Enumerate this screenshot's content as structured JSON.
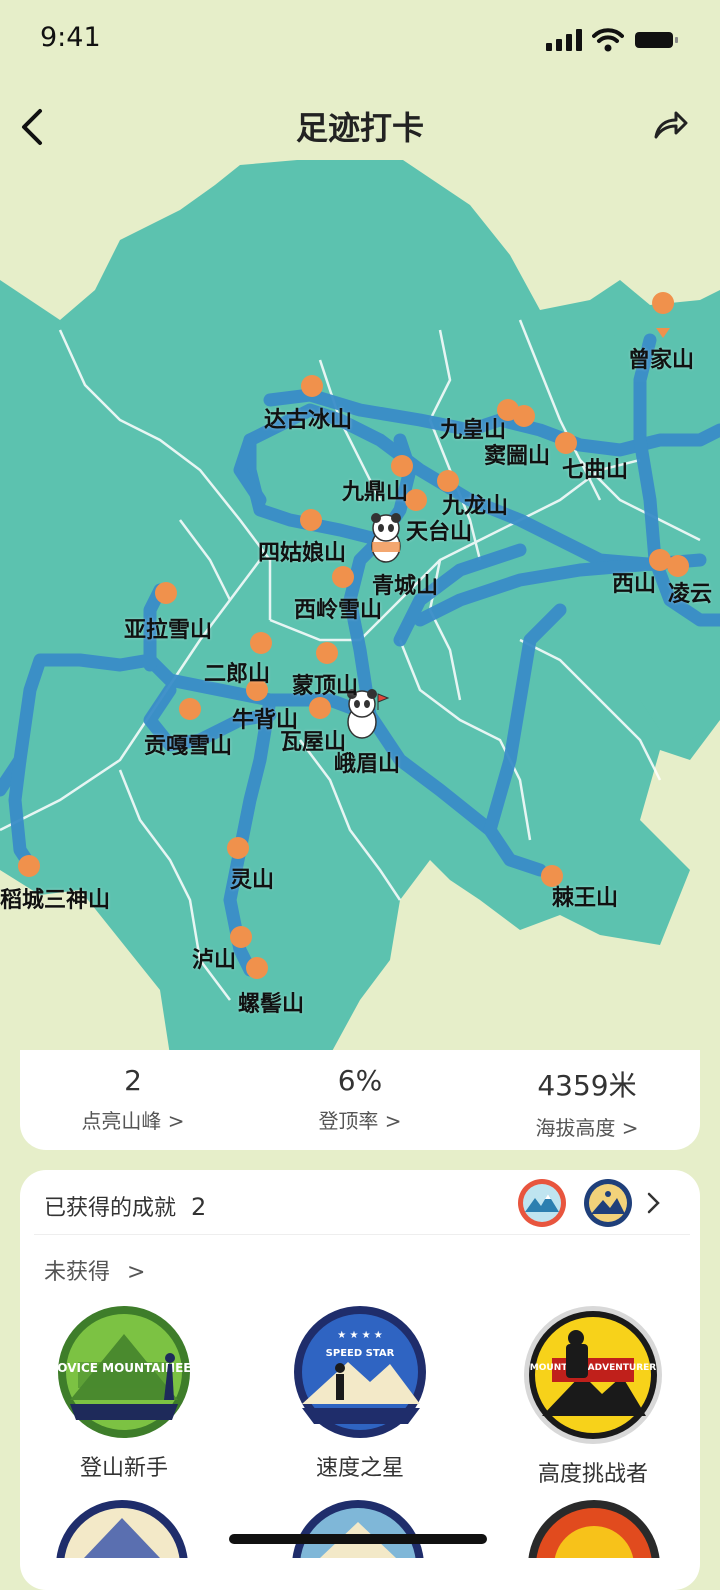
{
  "status": {
    "time": "9:41"
  },
  "nav": {
    "title": "足迹打卡"
  },
  "map": {
    "peaks": [
      {
        "name": "曾家山",
        "lit": false
      },
      {
        "name": "达古冰山",
        "lit": false
      },
      {
        "name": "九皇山",
        "lit": false
      },
      {
        "name": "窦圌山",
        "lit": false
      },
      {
        "name": "七曲山",
        "lit": false
      },
      {
        "name": "九鼎山",
        "lit": false
      },
      {
        "name": "九龙山",
        "lit": false
      },
      {
        "name": "天台山",
        "lit": false
      },
      {
        "name": "四姑娘山",
        "lit": false
      },
      {
        "name": "青城山",
        "lit": true
      },
      {
        "name": "西山",
        "lit": false
      },
      {
        "name": "凌云",
        "lit": false
      },
      {
        "name": "西岭雪山",
        "lit": false
      },
      {
        "name": "亚拉雪山",
        "lit": false
      },
      {
        "name": "二郎山",
        "lit": false
      },
      {
        "name": "蒙顶山",
        "lit": false
      },
      {
        "name": "牛背山",
        "lit": false
      },
      {
        "name": "贡嘎雪山",
        "lit": false
      },
      {
        "name": "瓦屋山",
        "lit": false
      },
      {
        "name": "峨眉山",
        "lit": true
      },
      {
        "name": "稻城三神山",
        "lit": false
      },
      {
        "name": "灵山",
        "lit": false
      },
      {
        "name": "棘王山",
        "lit": false
      },
      {
        "name": "泸山",
        "lit": false
      },
      {
        "name": "螺髻山",
        "lit": false
      }
    ]
  },
  "stats": [
    {
      "value": "2",
      "label": "点亮山峰 >"
    },
    {
      "value": "6%",
      "label": "登顶率 >"
    },
    {
      "value": "4359米",
      "label": "海拔高度 >"
    }
  ],
  "achievements": {
    "earned_label": "已获得的成就",
    "earned_count": "2",
    "unearned_label": "未获得",
    "badges": [
      {
        "name": "登山新手",
        "emblem_text": "NOVICE MOUNTAINEER"
      },
      {
        "name": "速度之星",
        "emblem_text": "SPEED STAR"
      },
      {
        "name": "高度挑战者",
        "emblem_text": "MOUNTAIN ADVENTURER"
      }
    ]
  },
  "colors": {
    "background": "#e6eec9",
    "province": "#5cc2af",
    "route": "#3a8dc8",
    "pin": "#f0914c"
  }
}
